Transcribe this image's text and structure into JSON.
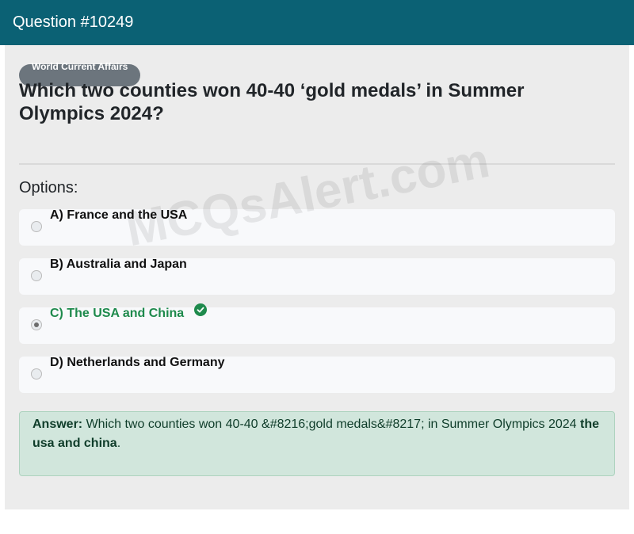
{
  "header": {
    "title": "Question #10249"
  },
  "category": {
    "label": "World Current Affairs"
  },
  "question": {
    "text": "Which two counties won 40-40 ‘gold medals’ in Summer Olympics 2024?"
  },
  "options_heading": "Options:",
  "options": [
    {
      "label": "A) France and the USA",
      "selected": false
    },
    {
      "label": "B) Australia and Japan",
      "selected": false
    },
    {
      "label": "C) The USA and China",
      "selected": true,
      "correct": true
    },
    {
      "label": "D) Netherlands and Germany",
      "selected": false
    }
  ],
  "answer": {
    "prefix": "Answer:",
    "text": " Which two counties won 40-40 &#8216;gold medals&#8217; in Summer Olympics 2024 ",
    "value": "the usa and china",
    "suffix": "."
  },
  "watermark": "MCQsAlert.com",
  "colors": {
    "header": "#0b6174",
    "correct": "#1e8a4c",
    "answer_bg": "#d1e6dc"
  }
}
